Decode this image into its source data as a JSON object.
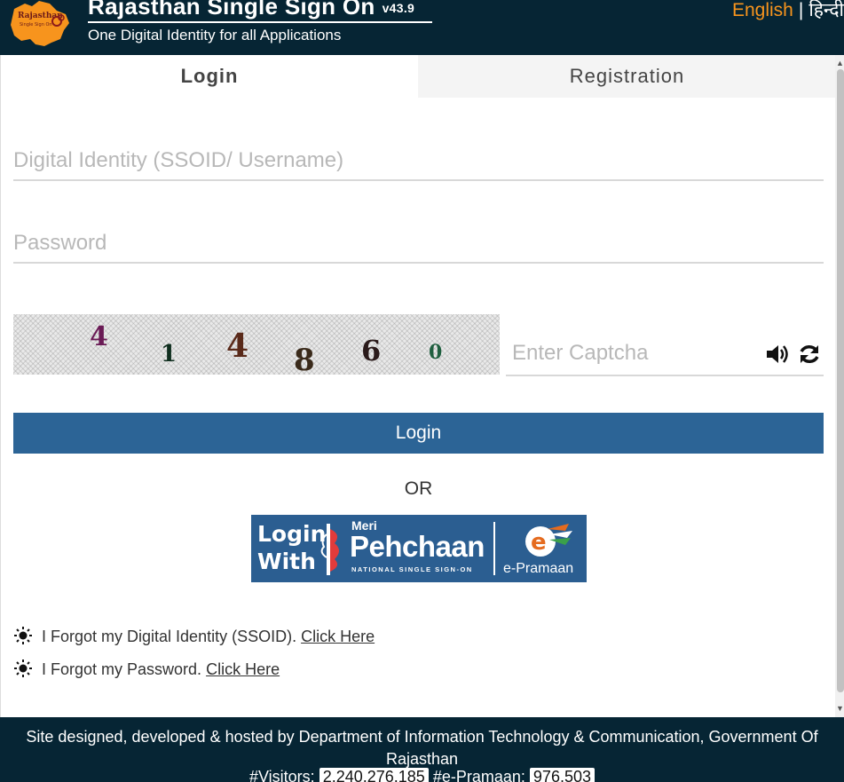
{
  "header": {
    "title": "Rajasthan Single Sign On",
    "version": "v43.9",
    "subtitle": "One Digital Identity for all Applications",
    "logo_text_line1": "Rajasthan",
    "logo_text_line2": "Single Sign On",
    "lang_english": "English",
    "lang_separator": "|",
    "lang_hindi": "हिन्दी"
  },
  "tabs": {
    "login": "Login",
    "registration": "Registration",
    "active": "Login"
  },
  "form": {
    "ssoid_placeholder": "Digital Identity (SSOID/ Username)",
    "ssoid_value": "",
    "password_placeholder": "Password",
    "password_value": "",
    "captcha_digits": [
      "4",
      "1",
      "4",
      "8",
      "6",
      "0"
    ],
    "captcha_placeholder": "Enter Captcha",
    "captcha_value": "",
    "audio_icon": "volume-up-icon",
    "refresh_icon": "refresh-icon",
    "login_button": "Login",
    "or_text": "OR"
  },
  "pehchaan": {
    "login_with_line1": "Login",
    "login_with_line2": "With",
    "meri": "Meri",
    "name": "Pehchaan",
    "tagline": "NATIONAL SINGLE SIGN-ON",
    "epramaan": "e-Pramaan"
  },
  "forgot": {
    "ssoid_text": "I Forgot my Digital Identity (SSOID).",
    "ssoid_link": "Click Here",
    "password_text": "I Forgot my Password.",
    "password_link": "Click Here"
  },
  "footer": {
    "credit": "Site designed, developed & hosted by Department of Information Technology & Communication, Government Of Rajasthan",
    "visitors_label": "#Visitors:",
    "visitors_count": "2,240,276,185",
    "epramaan_label": "#e-Pramaan:",
    "epramaan_count": "976,503"
  },
  "colors": {
    "header_bg": "#062534",
    "accent_orange": "#f7941d",
    "login_button": "#2c6496",
    "pehchaan_bg": "#2b5e91"
  }
}
